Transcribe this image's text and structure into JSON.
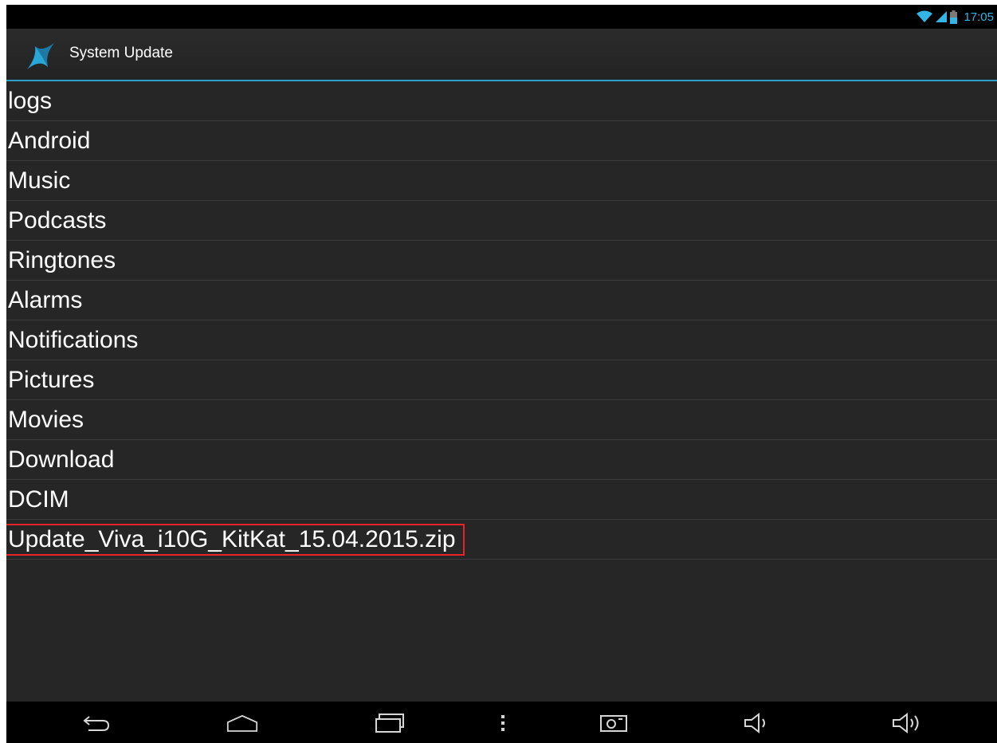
{
  "status_bar": {
    "time": "17:05",
    "icons": [
      "wifi-icon",
      "signal-icon",
      "battery-icon"
    ],
    "accent_color": "#33b5e5"
  },
  "action_bar": {
    "title": "System Update",
    "logo_icon": "system-update-logo-icon",
    "divider_color": "#2a9fc9"
  },
  "files": [
    {
      "name": "logs"
    },
    {
      "name": "Android"
    },
    {
      "name": "Music"
    },
    {
      "name": "Podcasts"
    },
    {
      "name": "Ringtones"
    },
    {
      "name": "Alarms"
    },
    {
      "name": "Notifications"
    },
    {
      "name": "Pictures"
    },
    {
      "name": "Movies"
    },
    {
      "name": "Download"
    },
    {
      "name": "DCIM"
    },
    {
      "name": "Update_Viva_i10G_KitKat_15.04.2015.zip",
      "highlighted": true,
      "highlight_color": "#e8232a"
    }
  ],
  "nav_bar": {
    "buttons": [
      "back-icon",
      "home-icon",
      "recent-apps-icon",
      "menu-icon",
      "screenshot-icon",
      "volume-down-icon",
      "volume-up-icon"
    ]
  }
}
